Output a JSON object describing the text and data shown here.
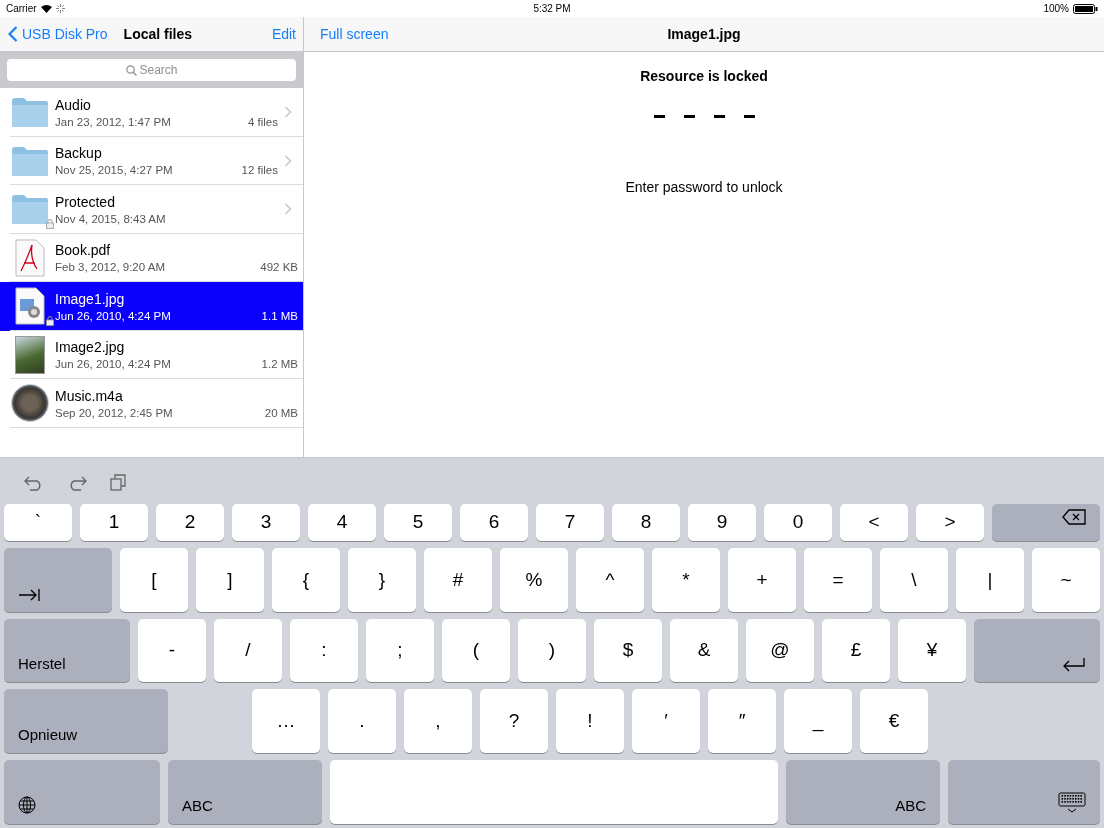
{
  "status_bar": {
    "carrier": "Carrier",
    "time": "5:32 PM",
    "battery": "100%"
  },
  "sidebar": {
    "back": "USB Disk Pro",
    "title": "Local files",
    "edit": "Edit",
    "search": {
      "placeholder": "Search"
    },
    "files": [
      {
        "kind": "folder",
        "name": "Audio",
        "date": "Jan 23, 2012, 1:47 PM",
        "detail": "4 files",
        "locked": false,
        "selected": false
      },
      {
        "kind": "folder",
        "name": "Backup",
        "date": "Nov 25, 2015, 4:27 PM",
        "detail": "12 files",
        "locked": false,
        "selected": false
      },
      {
        "kind": "folder",
        "name": "Protected",
        "date": "Nov 4, 2015, 8:43 AM",
        "locked": true,
        "selected": false
      },
      {
        "kind": "pdf",
        "name": "Book.pdf",
        "date": "Feb 3, 2012, 9:20 AM",
        "detail": "492 KB",
        "locked": false,
        "selected": false
      },
      {
        "kind": "document",
        "name": "Image1.jpg",
        "date": "Jun 26, 2010, 4:24 PM",
        "detail": "1.1 MB",
        "locked": true,
        "selected": true
      },
      {
        "kind": "photo",
        "name": "Image2.jpg",
        "date": "Jun 26, 2010, 4:24 PM",
        "detail": "1.2 MB",
        "locked": false,
        "selected": false
      },
      {
        "kind": "audio",
        "name": "Music.m4a",
        "date": "Sep 20, 2012, 2:45 PM",
        "detail": "20 MB",
        "locked": false,
        "selected": false
      }
    ]
  },
  "viewer": {
    "full_screen": "Full screen",
    "title": "Image1.jpg",
    "heading": "Resource is locked",
    "passcode": [
      {
        "filled": false
      },
      {
        "filled": false
      },
      {
        "filled": false
      },
      {
        "filled": false
      }
    ],
    "hint": "Enter password to unlock"
  },
  "keyboard": {
    "rows": [
      [
        {
          "kind": "char",
          "label": "`"
        },
        {
          "kind": "char",
          "label": "1"
        },
        {
          "kind": "char",
          "label": "2"
        },
        {
          "kind": "char",
          "label": "3"
        },
        {
          "kind": "char",
          "label": "4"
        },
        {
          "kind": "char",
          "label": "5"
        },
        {
          "kind": "char",
          "label": "6"
        },
        {
          "kind": "char",
          "label": "7"
        },
        {
          "kind": "char",
          "label": "8"
        },
        {
          "kind": "char",
          "label": "9"
        },
        {
          "kind": "char",
          "label": "0"
        },
        {
          "kind": "char",
          "label": "<"
        },
        {
          "kind": "char",
          "label": ">"
        },
        {
          "kind": "delete"
        }
      ],
      [
        {
          "kind": "tab"
        },
        {
          "kind": "char",
          "label": "["
        },
        {
          "kind": "char",
          "label": "]"
        },
        {
          "kind": "char",
          "label": "{"
        },
        {
          "kind": "char",
          "label": "}"
        },
        {
          "kind": "char",
          "label": "#"
        },
        {
          "kind": "char",
          "label": "%"
        },
        {
          "kind": "char",
          "label": "^"
        },
        {
          "kind": "char",
          "label": "*"
        },
        {
          "kind": "char",
          "label": "+"
        },
        {
          "kind": "char",
          "label": "="
        },
        {
          "kind": "char",
          "label": "\\"
        },
        {
          "kind": "char",
          "label": "|"
        },
        {
          "kind": "char",
          "label": "~"
        }
      ],
      [
        {
          "kind": "undo",
          "label": "Herstel"
        },
        {
          "kind": "char",
          "label": "-"
        },
        {
          "kind": "char",
          "label": "/"
        },
        {
          "kind": "char",
          "label": ":"
        },
        {
          "kind": "char",
          "label": ";"
        },
        {
          "kind": "char",
          "label": "("
        },
        {
          "kind": "char",
          "label": ")"
        },
        {
          "kind": "char",
          "label": "$"
        },
        {
          "kind": "char",
          "label": "&"
        },
        {
          "kind": "char",
          "label": "@"
        },
        {
          "kind": "char",
          "label": "£"
        },
        {
          "kind": "char",
          "label": "¥"
        },
        {
          "kind": "return"
        }
      ],
      [
        {
          "kind": "redo",
          "label": "Opnieuw"
        },
        {
          "kind": "char",
          "label": "…"
        },
        {
          "kind": "char",
          "label": "."
        },
        {
          "kind": "char",
          "label": ","
        },
        {
          "kind": "char",
          "label": "?"
        },
        {
          "kind": "char",
          "label": "!"
        },
        {
          "kind": "char",
          "label": "′"
        },
        {
          "kind": "char",
          "label": "″"
        },
        {
          "kind": "char",
          "label": "_"
        },
        {
          "kind": "char",
          "label": "€"
        }
      ],
      [
        {
          "kind": "globe"
        },
        {
          "kind": "abc",
          "label": "ABC"
        },
        {
          "kind": "space"
        },
        {
          "kind": "abc",
          "label": "ABC"
        },
        {
          "kind": "dismiss"
        }
      ]
    ]
  }
}
